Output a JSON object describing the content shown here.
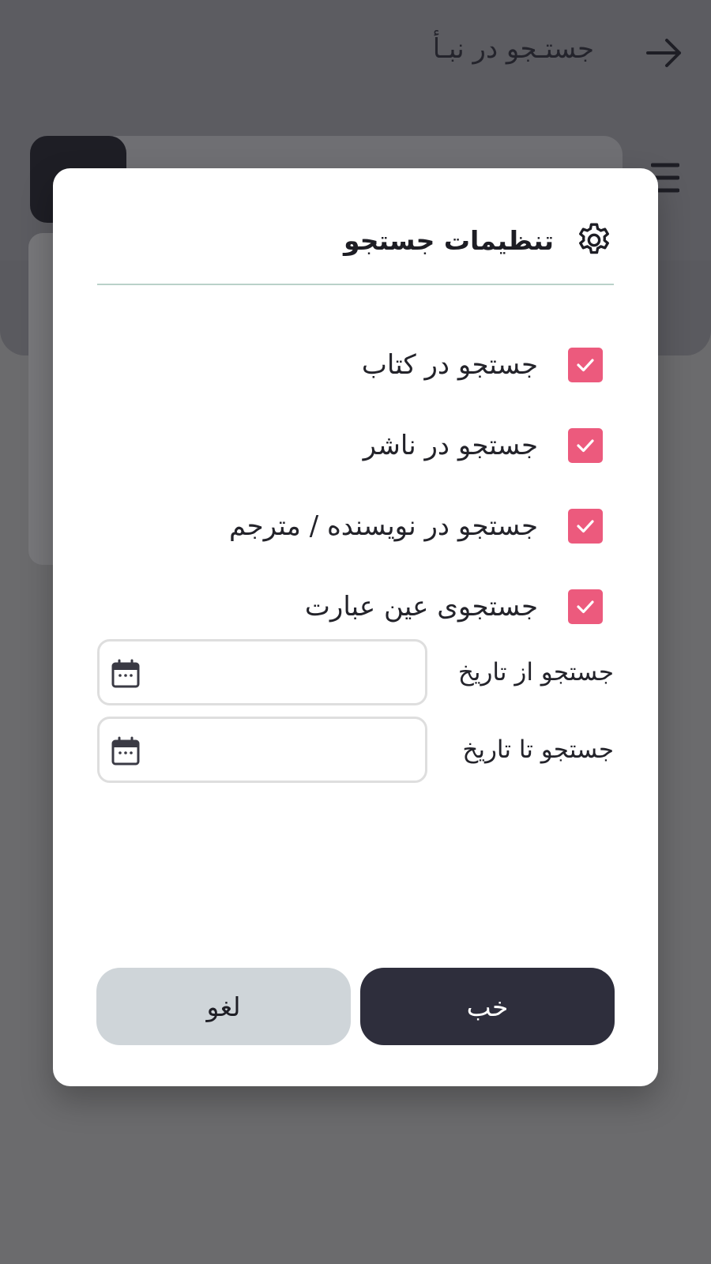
{
  "app": {
    "title": "جستـجو در نبـأ"
  },
  "dialog": {
    "title": "تنظیمات جستجو",
    "options": [
      {
        "label": "جستجو در کتاب",
        "checked": true
      },
      {
        "label": "جستجو در ناشر",
        "checked": true
      },
      {
        "label": "جستجو در نویسنده / مترجم",
        "checked": true
      },
      {
        "label": "جستجوی عین عبارت",
        "checked": true
      }
    ],
    "date_from": {
      "label": "جستجو از تاریخ",
      "value": ""
    },
    "date_to": {
      "label": "جستجو تا تاریخ",
      "value": ""
    },
    "ok_label": "خب",
    "cancel_label": "لغو"
  },
  "colors": {
    "accent_checkbox": "#ec5a7d",
    "primary_button": "#2e2e3c",
    "secondary_button": "#cfd5d9",
    "divider": "#b9d1c9"
  },
  "icons": {
    "back": "arrow-right-icon",
    "menu": "hamburger-menu-icon",
    "settings": "gear-icon",
    "checkbox": "check-icon",
    "calendar": "calendar-icon"
  }
}
